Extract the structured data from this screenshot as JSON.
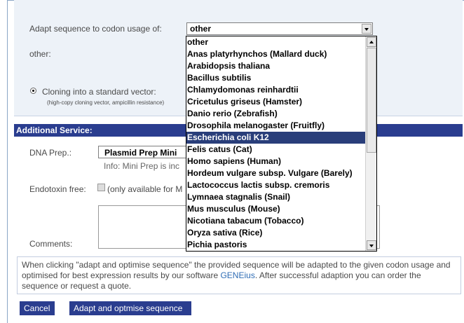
{
  "codon": {
    "label": "Adapt sequence to codon usage of:",
    "selected": "other"
  },
  "other_label": "other:",
  "cloning": {
    "label": "Cloning into a standard vector:",
    "sub": "(high-copy cloning vector, ampicillin resistance)"
  },
  "additional_service": "Additional Service:",
  "dna_prep": {
    "label": "DNA Prep.:",
    "value": "Plasmid Prep Mini",
    "info": "Info: Mini Prep is inc"
  },
  "endotoxin": {
    "label": "Endotoxin free:",
    "note": "(only available for M"
  },
  "comments_label": "Comments:",
  "info_text_1": "When clicking \"adapt and optimise sequence\" the provided sequence will be adapted to the given codon usage and optimised for best expression results by our software ",
  "info_link": "GENEius",
  "info_text_2": ". After successful adaption you can order the sequence or request a quote.",
  "buttons": {
    "cancel": "Cancel",
    "adapt": "Adapt and optmise sequence"
  },
  "dropdown_options": [
    "other",
    "Anas platyrhynchos (Mallard duck)",
    "Arabidopsis thaliana",
    "Bacillus subtilis",
    "Chlamydomonas reinhardtii",
    "Cricetulus griseus (Hamster)",
    "Danio rerio (Zebrafish)",
    "Drosophila melanogaster (Fruitfly)",
    "Escherichia coli K12",
    "Felis catus (Cat)",
    "Homo sapiens (Human)",
    "Hordeum vulgare subsp. Vulgare (Barely)",
    "Lactococcus lactis subsp. cremoris",
    "Lymnaea stagnalis (Snail)",
    "Mus musculus (Mouse)",
    "Nicotiana tabacum (Tobacco)",
    "Oryza sativa (Rice)",
    "Pichia pastoris"
  ],
  "dropdown_highlighted": "Escherichia coli K12",
  "colors": {
    "accent": "#2a3d8f",
    "panel": "#edf2f8",
    "link": "#2f6db5"
  }
}
